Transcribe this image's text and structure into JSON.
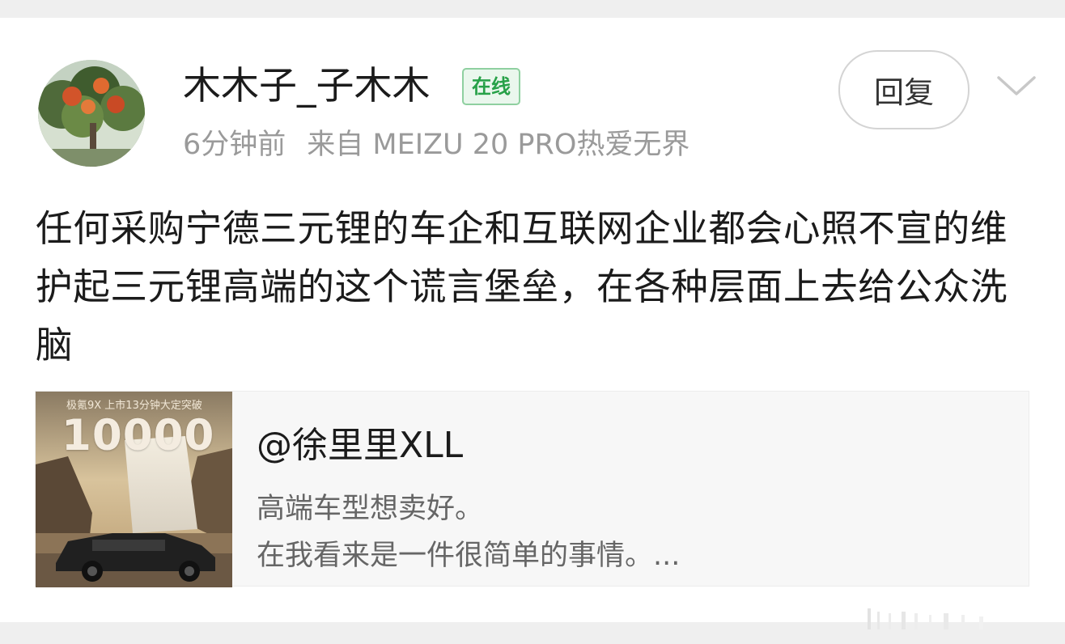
{
  "post": {
    "username": "木木子_子木木",
    "online_badge": "在线",
    "time": "6分钟前",
    "source": "来自 MEIZU 20 PRO热爱无界",
    "reply_label": "回复",
    "content": "任何采购宁德三元锂的车企和互联网企业都会心照不宣的维护起三元锂高端的这个谎言堡垒，在各种层面上去给公众洗脑"
  },
  "repost": {
    "thumbnail": {
      "caption": "极氪9X 上市13分钟大定突破",
      "number": "10000"
    },
    "author": "@徐里里XLL",
    "line1": "高端车型想卖好。",
    "line2": "在我看来是一件很简单的事情。..."
  },
  "icons": {
    "expand": "chevron-down-icon",
    "avatar": "tree-photo"
  },
  "colors": {
    "online_green": "#27a148",
    "meta_gray": "#9a9a9a",
    "page_bg": "#efefef"
  }
}
